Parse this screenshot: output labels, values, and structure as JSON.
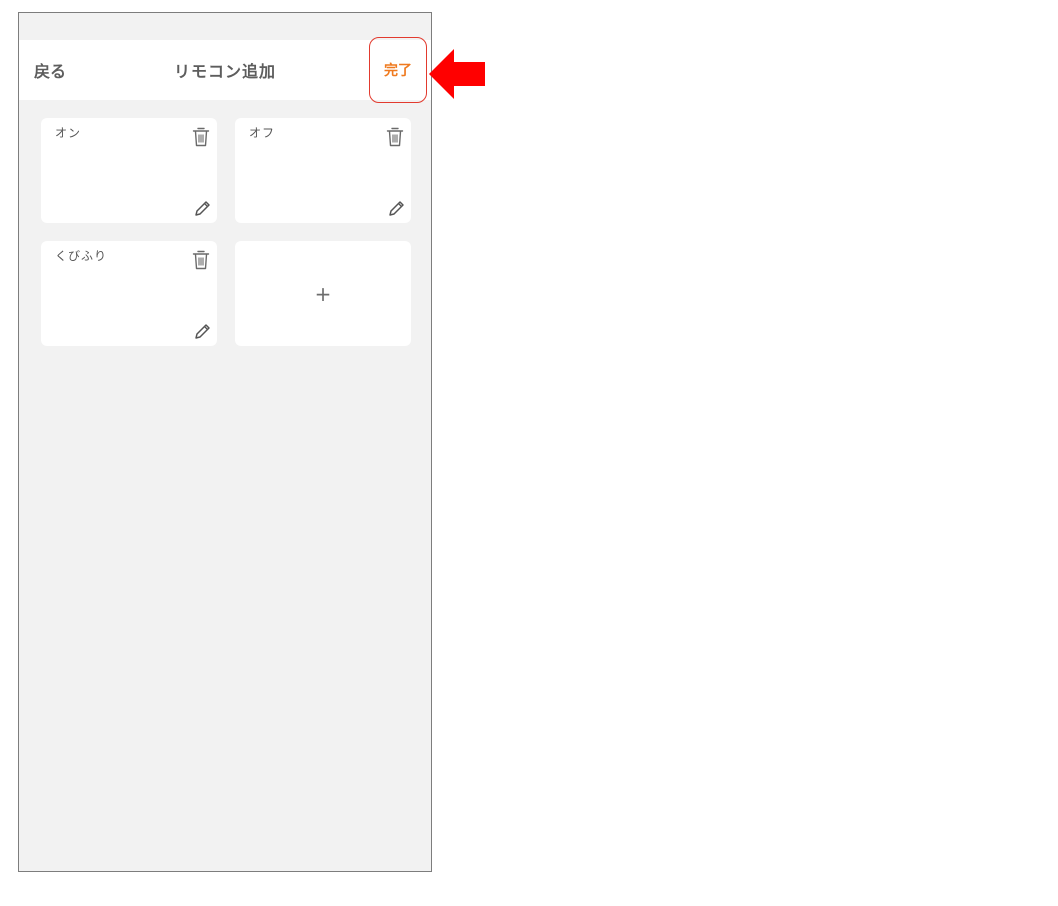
{
  "header": {
    "back_label": "戻る",
    "title": "リモコン追加",
    "done_label": "完了"
  },
  "cards": [
    {
      "label": "オン"
    },
    {
      "label": "オフ"
    },
    {
      "label": "くびふり"
    }
  ],
  "add_card": {
    "symbol": "+"
  },
  "colors": {
    "accent": "#ef7a1f",
    "highlight": "#e23a2e",
    "arrow": "#ff0000",
    "background": "#f2f2f2"
  },
  "icons": {
    "delete": "trash-icon",
    "edit": "pencil-icon",
    "annotation": "arrow-left-icon"
  }
}
